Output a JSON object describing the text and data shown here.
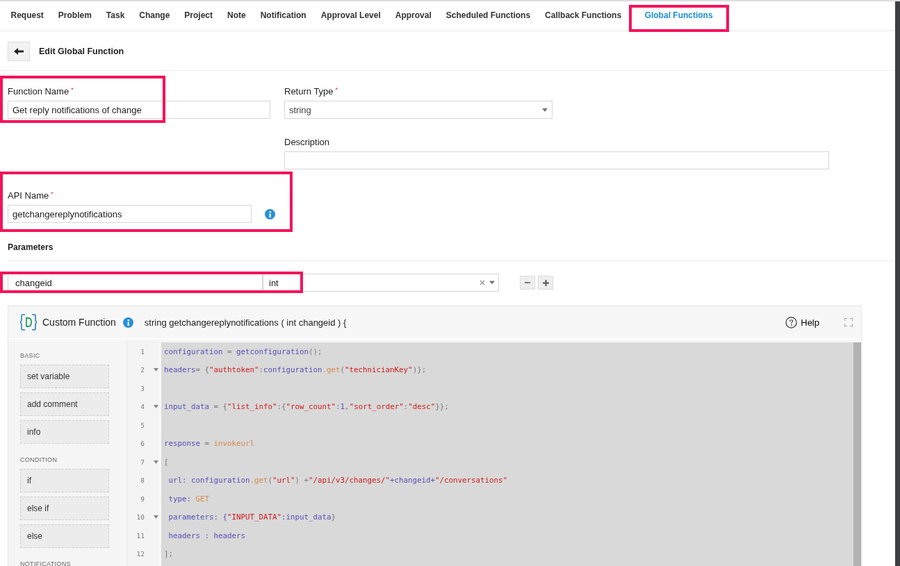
{
  "tabs": [
    {
      "label": "Request",
      "selected": false
    },
    {
      "label": "Problem",
      "selected": false
    },
    {
      "label": "Task",
      "selected": false
    },
    {
      "label": "Change",
      "selected": false
    },
    {
      "label": "Project",
      "selected": false
    },
    {
      "label": "Note",
      "selected": false
    },
    {
      "label": "Notification",
      "selected": false
    },
    {
      "label": "Approval Level",
      "selected": false
    },
    {
      "label": "Approval",
      "selected": false
    },
    {
      "label": "Scheduled Functions",
      "selected": false
    },
    {
      "label": "Callback Functions",
      "selected": false
    },
    {
      "label": "Global Functions",
      "selected": true
    }
  ],
  "page_title": "Edit Global Function",
  "form": {
    "function_name": {
      "label": "Function Name",
      "required_mark": "*",
      "value": "Get reply notifications of change"
    },
    "return_type": {
      "label": "Return Type",
      "required_mark": "*",
      "value": "string"
    },
    "description": {
      "label": "Description"
    },
    "api_name": {
      "label": "API Name",
      "required_mark": "*",
      "value": "getchangereplynotifications"
    }
  },
  "parameters": {
    "title": "Parameters",
    "rows": [
      {
        "name": "changeid",
        "type": "int"
      }
    ]
  },
  "editor": {
    "title": "Custom Function",
    "signature": "string getchangereplynotifications ( int changeid ) {",
    "help": "Help",
    "palette": [
      {
        "section": "BASIC",
        "items": [
          "set variable",
          "add comment",
          "info"
        ]
      },
      {
        "section": "CONDITION",
        "items": [
          "if",
          "else if",
          "else"
        ]
      },
      {
        "section": "NOTIFICATIONS"
      }
    ],
    "lines": [
      {
        "num": "1",
        "fold": false,
        "tokens": [
          {
            "t": "configuration",
            "kind": "var"
          },
          {
            "t": " = ",
            "kind": "punct"
          },
          {
            "t": "getconfiguration",
            "kind": "var"
          },
          {
            "t": "();",
            "kind": "punct"
          }
        ]
      },
      {
        "num": "2",
        "fold": true,
        "tokens": [
          {
            "t": "headers",
            "kind": "var"
          },
          {
            "t": "= {",
            "kind": "punct"
          },
          {
            "t": "\"authtoken\"",
            "kind": "str"
          },
          {
            "t": ":",
            "kind": "punct"
          },
          {
            "t": "configuration",
            "kind": "var"
          },
          {
            "t": ".get",
            "kind": "fn"
          },
          {
            "t": "(",
            "kind": "punct"
          },
          {
            "t": "\"technicianKey\"",
            "kind": "str"
          },
          {
            "t": ")};",
            "kind": "punct"
          }
        ]
      },
      {
        "num": "3",
        "fold": false
      },
      {
        "num": "4",
        "fold": true,
        "tokens": [
          {
            "t": "input_data",
            "kind": "var"
          },
          {
            "t": " = {",
            "kind": "punct"
          },
          {
            "t": "\"list_info\"",
            "kind": "str"
          },
          {
            "t": ":{",
            "kind": "punct"
          },
          {
            "t": "\"row_count\"",
            "kind": "str"
          },
          {
            "t": ":",
            "kind": "punct"
          },
          {
            "t": "1",
            "kind": "var"
          },
          {
            "t": ",",
            "kind": "punct"
          },
          {
            "t": "\"sort_order\"",
            "kind": "str"
          },
          {
            "t": ":",
            "kind": "punct"
          },
          {
            "t": "\"desc\"",
            "kind": "str"
          },
          {
            "t": "}};",
            "kind": "punct"
          }
        ]
      },
      {
        "num": "5",
        "fold": false
      },
      {
        "num": "6",
        "fold": false,
        "tokens": [
          {
            "t": "response",
            "kind": "var"
          },
          {
            "t": " = ",
            "kind": "punct"
          },
          {
            "t": "invokeurl",
            "kind": "fn"
          }
        ]
      },
      {
        "num": "7",
        "fold": true,
        "tokens": [
          {
            "t": "[",
            "kind": "punct"
          }
        ]
      },
      {
        "num": "8",
        "fold": false,
        "tokens": [
          {
            "t": " url: configuration",
            "kind": "var"
          },
          {
            "t": ".get",
            "kind": "fn"
          },
          {
            "t": "(",
            "kind": "punct"
          },
          {
            "t": "\"url\"",
            "kind": "str"
          },
          {
            "t": ") +",
            "kind": "punct"
          },
          {
            "t": "\"/api/v3/changes/\"",
            "kind": "str"
          },
          {
            "t": "+changeid+",
            "kind": "var"
          },
          {
            "t": "\"/conversations\"",
            "kind": "str"
          }
        ]
      },
      {
        "num": "9",
        "fold": false,
        "tokens": [
          {
            "t": " type: ",
            "kind": "var"
          },
          {
            "t": "GET",
            "kind": "fn"
          }
        ]
      },
      {
        "num": "10",
        "fold": true,
        "tokens": [
          {
            "t": " parameters: {",
            "kind": "var"
          },
          {
            "t": "\"INPUT_DATA\"",
            "kind": "str"
          },
          {
            "t": ":input_data",
            "kind": "var"
          },
          {
            "t": "}",
            "kind": "punct"
          }
        ]
      },
      {
        "num": "11",
        "fold": false,
        "tokens": [
          {
            "t": " headers : headers",
            "kind": "var"
          }
        ]
      },
      {
        "num": "12",
        "fold": false,
        "tokens": [
          {
            "t": "];",
            "kind": "punct"
          }
        ]
      }
    ]
  }
}
